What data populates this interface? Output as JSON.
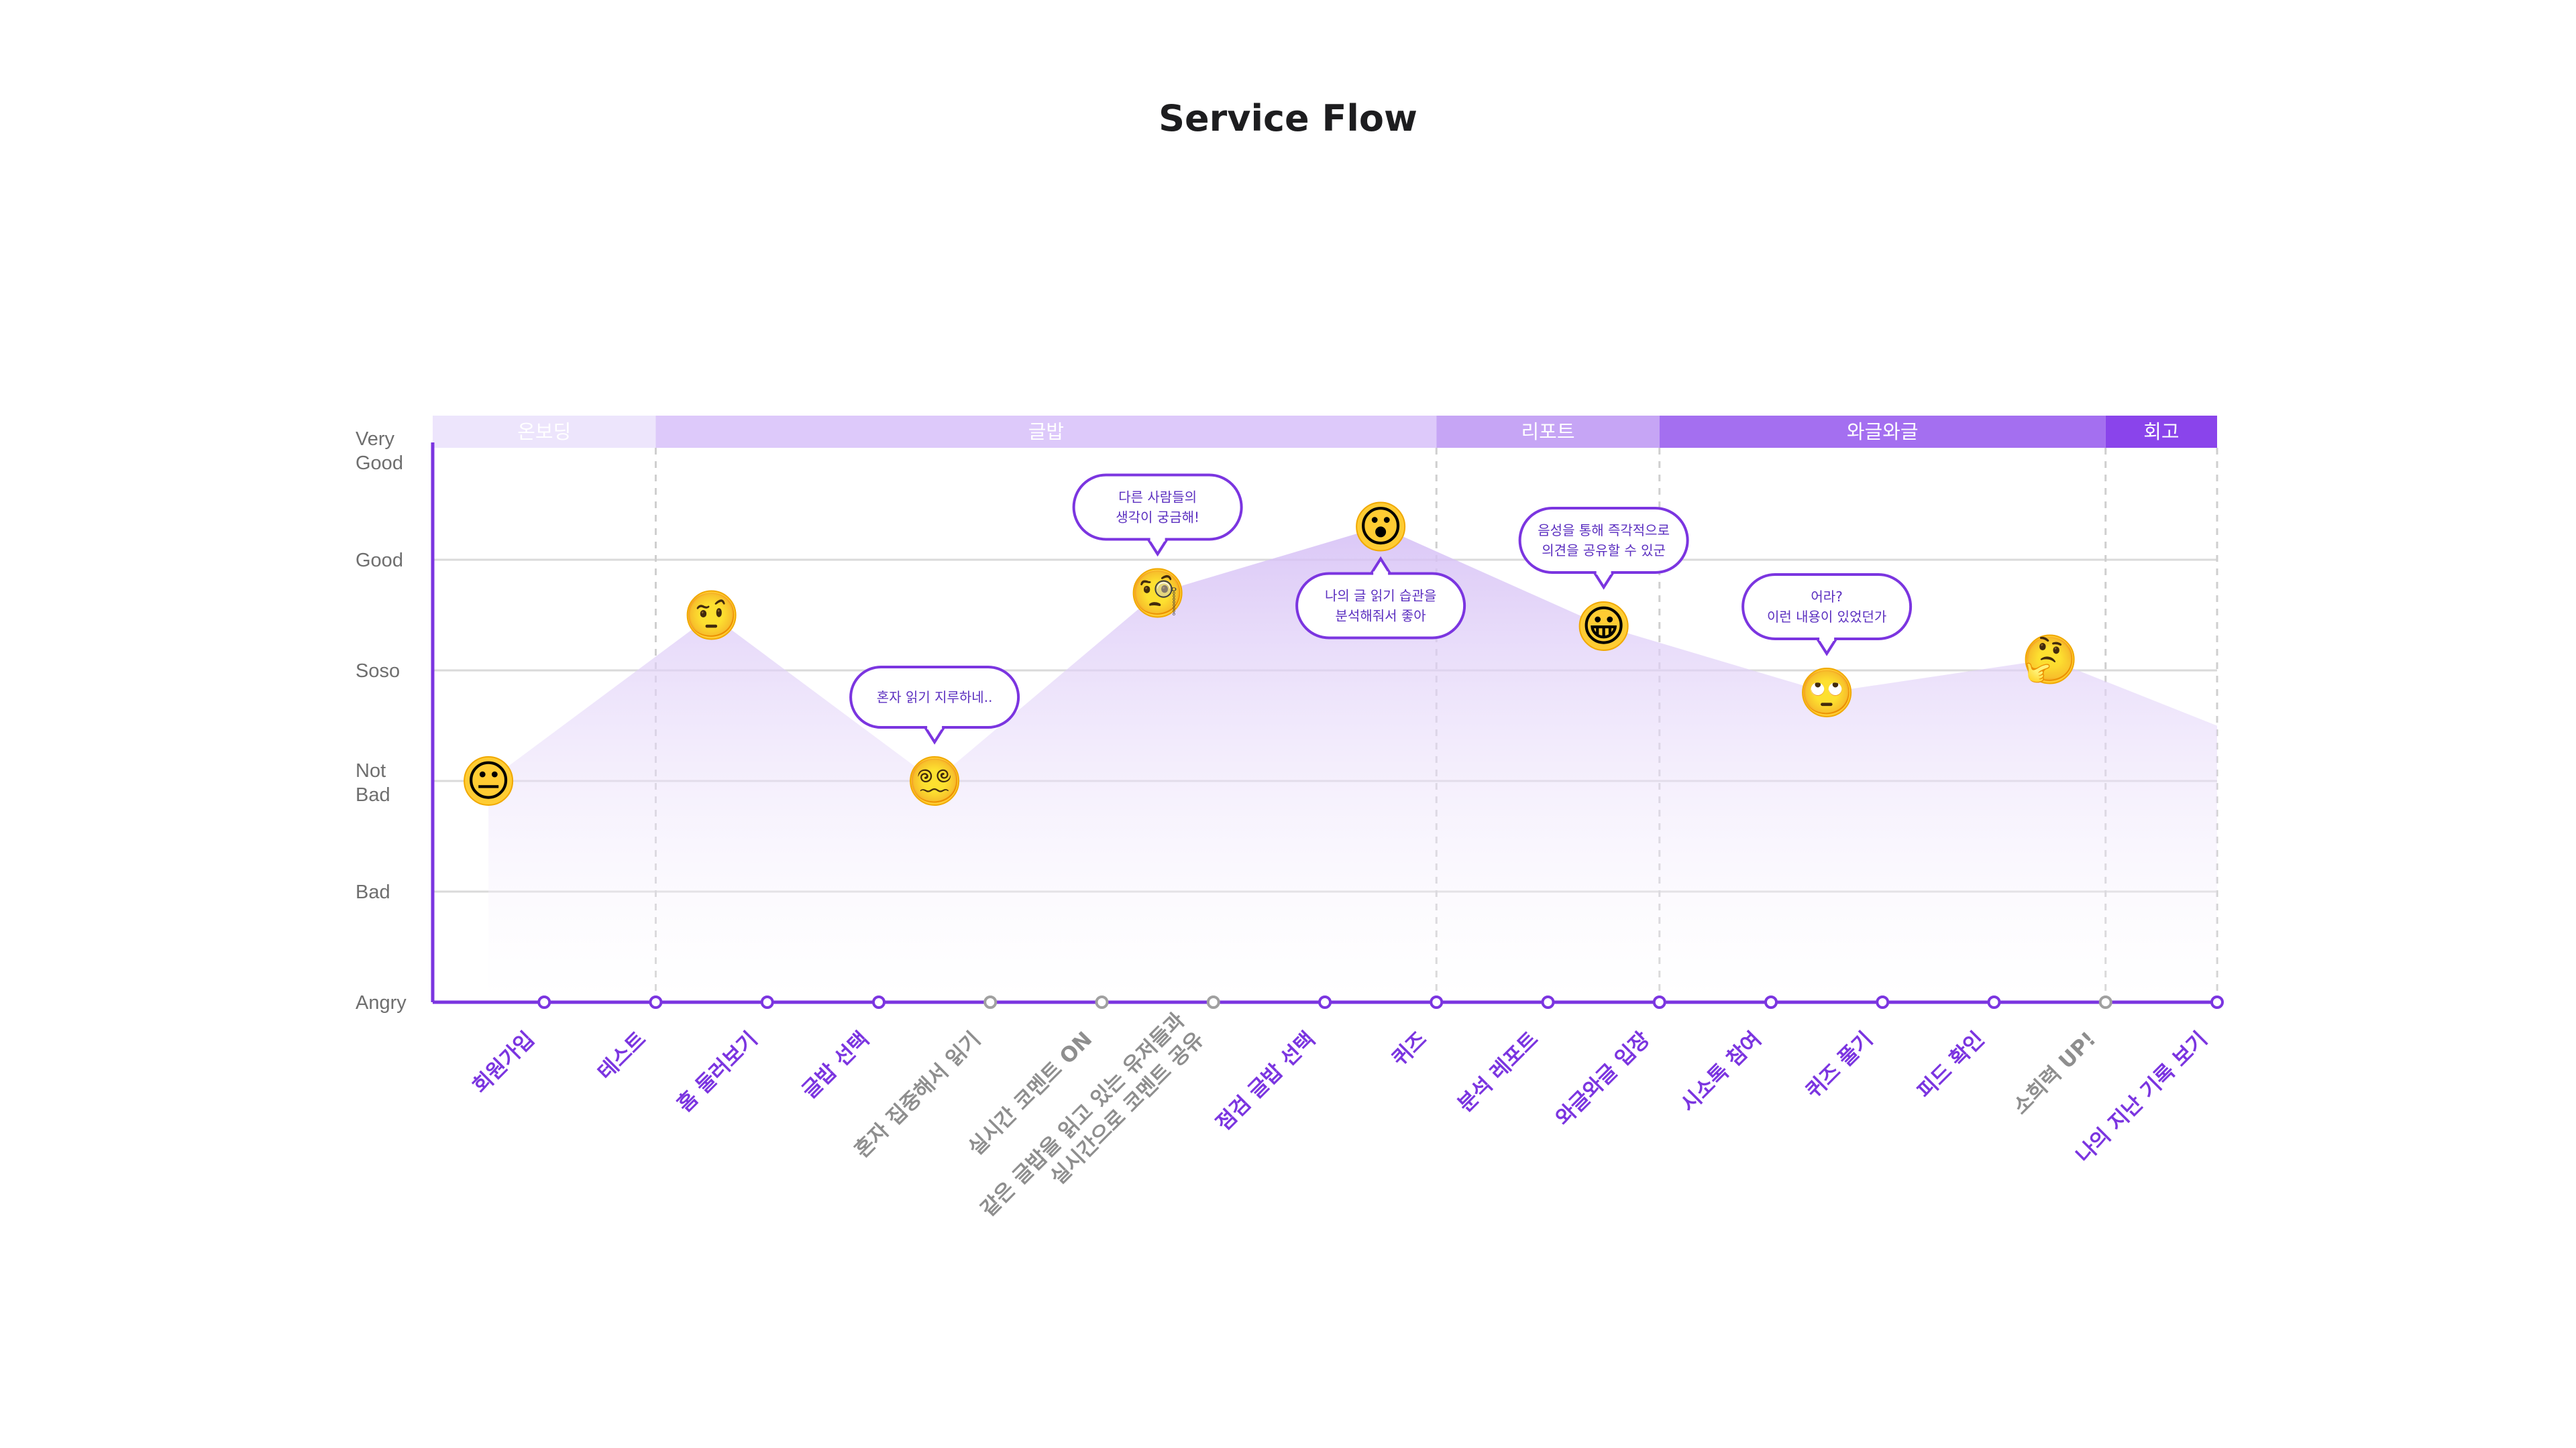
{
  "title": "Service Flow",
  "y_levels": [
    {
      "label_lines": [
        "Very",
        "Good"
      ],
      "value": 5
    },
    {
      "label_lines": [
        "Good"
      ],
      "value": 4
    },
    {
      "label_lines": [
        "Soso"
      ],
      "value": 3
    },
    {
      "label_lines": [
        "Not",
        "Bad"
      ],
      "value": 2
    },
    {
      "label_lines": [
        "Bad"
      ],
      "value": 1
    },
    {
      "label_lines": [
        "Angry"
      ],
      "value": 0
    }
  ],
  "phases": [
    {
      "label": "온보딩",
      "start": 0,
      "end": 2,
      "color": "#ede5fc",
      "text_color": "#ffffff"
    },
    {
      "label": "글밥",
      "start": 2,
      "end": 9,
      "color": "#ddc9fa",
      "text_color": "#ffffff"
    },
    {
      "label": "리포트",
      "start": 9,
      "end": 11,
      "color": "#c6a5f5",
      "text_color": "#ffffff"
    },
    {
      "label": "와글와글",
      "start": 11,
      "end": 15,
      "color": "#a46ff0",
      "text_color": "#ffffff"
    },
    {
      "label": "회고",
      "start": 15,
      "end": 16,
      "color": "#8a44eb",
      "text_color": "#ffffff"
    }
  ],
  "steps": [
    {
      "label_lines": [
        "회원가입"
      ],
      "active": true
    },
    {
      "label_lines": [
        "테스트"
      ],
      "active": true
    },
    {
      "label_lines": [
        "홈 둘러보기"
      ],
      "active": true
    },
    {
      "label_lines": [
        "글밥 선택"
      ],
      "active": true
    },
    {
      "label_lines": [
        "혼자 집중해서 읽기"
      ],
      "active": false
    },
    {
      "label_lines": [
        "실시간 코멘트 ON"
      ],
      "active": false
    },
    {
      "label_lines": [
        "같은 글밥을 읽고 있는 유저들과",
        "실시간으로 코멘트 공유"
      ],
      "active": false
    },
    {
      "label_lines": [
        "점검 글밥 선택"
      ],
      "active": true
    },
    {
      "label_lines": [
        "퀴즈"
      ],
      "active": true
    },
    {
      "label_lines": [
        "분석 레포트"
      ],
      "active": true
    },
    {
      "label_lines": [
        "와글와글 입장"
      ],
      "active": true
    },
    {
      "label_lines": [
        "시소톡 참여"
      ],
      "active": true
    },
    {
      "label_lines": [
        "퀴즈 풀기"
      ],
      "active": true
    },
    {
      "label_lines": [
        "피드 확인"
      ],
      "active": true
    },
    {
      "label_lines": [
        "소희력 UP!"
      ],
      "active": false
    },
    {
      "label_lines": [
        "나의 지난 기록 보기"
      ],
      "active": true
    }
  ],
  "emotion_points": [
    {
      "x": 0.5,
      "value": 2.0,
      "emoji": "😐",
      "name": "neutral-face"
    },
    {
      "x": 2.5,
      "value": 3.5,
      "emoji": "🤨",
      "name": "raised-eyebrow-face"
    },
    {
      "x": 4.5,
      "value": 2.0,
      "emoji": "😵‍💫",
      "name": "dizzy-face"
    },
    {
      "x": 6.5,
      "value": 3.7,
      "emoji": "🧐",
      "name": "monocle-face"
    },
    {
      "x": 8.5,
      "value": 4.3,
      "emoji": "😮",
      "name": "surprised-face"
    },
    {
      "x": 10.5,
      "value": 3.4,
      "emoji": "😀",
      "name": "grinning-face"
    },
    {
      "x": 12.5,
      "value": 2.8,
      "emoji": "🙄",
      "name": "eye-roll-face"
    },
    {
      "x": 14.5,
      "value": 3.1,
      "emoji": "🤔",
      "name": "thinking-face"
    }
  ],
  "curve_end_value": 2.5,
  "bubbles": [
    {
      "lines": [
        "혼자 읽기 지루하네.."
      ],
      "point": 2,
      "side": "above"
    },
    {
      "lines": [
        "다른 사람들의",
        "생각이 궁금해!"
      ],
      "point": 3,
      "side": "above"
    },
    {
      "lines": [
        "나의 글 읽기 습관을",
        "분석해줘서 좋아"
      ],
      "point": 4,
      "side": "below"
    },
    {
      "lines": [
        "음성을 통해 즉각적으로",
        "의견을 공유할 수 있군"
      ],
      "point": 5,
      "side": "above"
    },
    {
      "lines": [
        "어라?",
        "이런 내용이 있었던가"
      ],
      "point": 6,
      "side": "above"
    }
  ],
  "colors": {
    "accent": "#7b35e0",
    "inactive": "#8e8e8e",
    "grid": "#dadada",
    "area_top": "#d9c4f5",
    "bubble_border": "#7b35e0"
  }
}
